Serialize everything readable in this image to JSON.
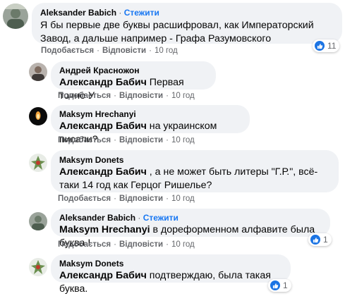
{
  "colors": {
    "bubble": "#f0f2f5",
    "accent": "#1877f2",
    "meta": "#65676b",
    "like": "#1b74e4"
  },
  "comments": [
    {
      "author": "Aleksander Babich",
      "follow": "Стежити",
      "text": "Я бы первые две буквы расшифровал, как Императорский Завод, а дальше например - Графа Разумовского",
      "like_label": "Подобається",
      "reply_label": "Відповісти",
      "time": "10 год",
      "reactions": {
        "icon": "like-icon",
        "count": "11"
      }
    },
    {
      "author": "Андрей Красножон",
      "mention": "Александр Бабич",
      "text": " Первая точно У",
      "like_label": "Подобається",
      "reply_label": "Відповісти",
      "time": "10 год"
    },
    {
      "author": "Maksym Hrechanyi",
      "mention": "Александр Бабич",
      "text": " на украинском писали?",
      "like_label": "Подобається",
      "reply_label": "Відповісти",
      "time": "10 год"
    },
    {
      "author": "Maksym Donets",
      "mention": "Александр Бабич",
      "text": " , а не может быть литеры \"Г.Р.\", всё-таки 14 год как Герцог Ришелье?",
      "like_label": "Подобається",
      "reply_label": "Відповісти",
      "time": "10 год"
    },
    {
      "author": "Aleksander Babich",
      "follow": "Стежити",
      "mention": "Maksym Hrechanyi",
      "text": " в дореформенном алфавите была буква І",
      "like_label": "Подобається",
      "reply_label": "Відповісти",
      "time": "10 год",
      "reactions": {
        "icon": "like-icon",
        "count": "1"
      }
    },
    {
      "author": "Maksym Donets",
      "mention": "Александр Бабич",
      "text": " подтверждаю, была такая буква.",
      "like_label": "Подобається",
      "reply_label": "Відповісти",
      "time": "10 год",
      "reactions": {
        "icon": "like-icon",
        "count": "1"
      }
    }
  ]
}
